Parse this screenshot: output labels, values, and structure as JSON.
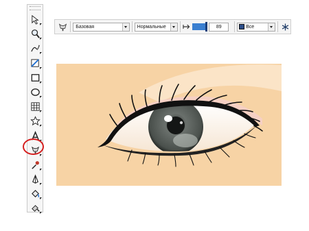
{
  "toolbox": {
    "tools": [
      {
        "name": "pick-tool-icon",
        "active": false
      },
      {
        "name": "zoom-tool-icon",
        "active": false
      },
      {
        "name": "freehand-tool-icon",
        "active": false
      },
      {
        "name": "smart-fill-tool-icon",
        "active": false
      },
      {
        "name": "rectangle-tool-icon",
        "active": false
      },
      {
        "name": "ellipse-tool-icon",
        "active": false
      },
      {
        "name": "graph-paper-tool-icon",
        "active": false
      },
      {
        "name": "star-tool-icon",
        "active": false
      },
      {
        "name": "text-tool-icon",
        "active": false
      },
      {
        "name": "blend-tool-icon",
        "active": true
      },
      {
        "name": "eyedropper-tool-icon",
        "active": false
      },
      {
        "name": "outline-tool-icon",
        "active": false
      },
      {
        "name": "fill-tool-icon",
        "active": false
      },
      {
        "name": "interactive-fill-tool-icon",
        "active": false
      }
    ],
    "highlight_color": "#d51e1e"
  },
  "property_bar": {
    "preset_value": "Базовая",
    "merge_mode_value": "Нормальные",
    "transparency_value": "89",
    "transparency_level_percent": 89,
    "apply_to_value": "Все"
  },
  "canvas": {
    "background_color": "#f7d3a5",
    "iris_color": "#5a605c"
  }
}
